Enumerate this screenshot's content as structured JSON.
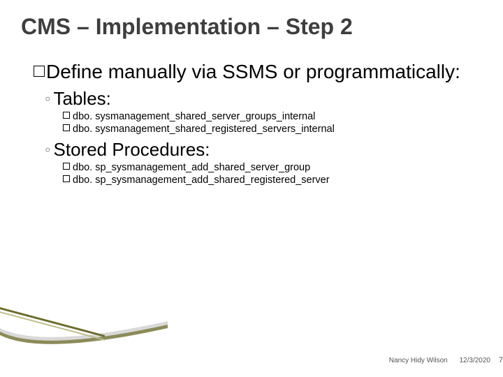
{
  "title": "CMS – Implementation – Step 2",
  "bullet_main": "Define manually via SSMS or programmatically:",
  "sections": {
    "tables": {
      "heading": "Tables:",
      "items": [
        "dbo. sysmanagement_shared_server_groups_internal",
        "dbo. sysmanagement_shared_registered_servers_internal"
      ]
    },
    "procs": {
      "heading": "Stored Procedures:",
      "items": [
        "dbo. sp_sysmanagement_add_shared_server_group",
        "dbo. sp_sysmanagement_add_shared_registered_server"
      ]
    }
  },
  "footer": {
    "author": "Nancy Hidy Wilson",
    "date": "12/3/2020",
    "page": "7"
  }
}
